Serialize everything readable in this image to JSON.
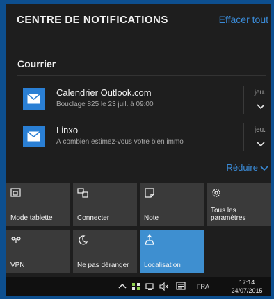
{
  "header": {
    "title": "CENTRE DE NOTIFICATIONS",
    "clear_all": "Effacer tout"
  },
  "group": {
    "name": "Courrier"
  },
  "notifications": [
    {
      "title": "Calendrier Outlook.com",
      "body": "Bouclage 825 le 23 juil. à 09:00",
      "time": "jeu.",
      "icon": "mail-icon"
    },
    {
      "title": "Linxo",
      "body": "À combien estimez-vous votre bien immo",
      "time": "jeu.",
      "icon": "mail-icon"
    }
  ],
  "collapse_label": "Réduire",
  "quick_actions": [
    {
      "label": "Mode tablette",
      "icon": "tablet-mode-icon",
      "active": false
    },
    {
      "label": "Connecter",
      "icon": "connect-icon",
      "active": false
    },
    {
      "label": "Note",
      "icon": "note-icon",
      "active": false
    },
    {
      "label": "Tous les paramètres",
      "icon": "gear-icon",
      "active": false
    },
    {
      "label": "VPN",
      "icon": "vpn-icon",
      "active": false
    },
    {
      "label": "Ne pas déranger",
      "icon": "moon-icon",
      "active": false
    },
    {
      "label": "Localisation",
      "icon": "location-icon",
      "active": true
    }
  ],
  "taskbar": {
    "language": "FRA",
    "time": "17:14",
    "date": "24/07/2015",
    "tray_icons": [
      "chevron-up-icon",
      "network-icon",
      "battery-icon",
      "volume-icon",
      "action-center-icon"
    ]
  },
  "colors": {
    "accent": "#3e8fd0",
    "link": "#3a8ad6",
    "panel": "#1e1e1e",
    "tile": "#3a3a3a",
    "frame": "#0d4f8f"
  }
}
